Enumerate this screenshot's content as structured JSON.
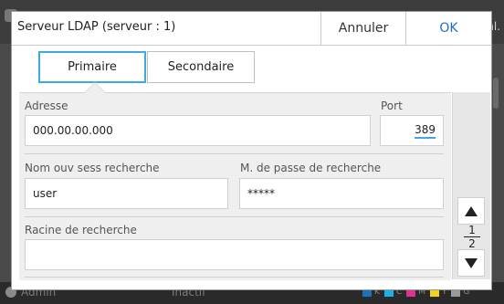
{
  "dialog": {
    "title": "Serveur LDAP (serveur : 1)",
    "cancel_label": "Annuler",
    "ok_label": "OK"
  },
  "tabs": [
    {
      "label": "Primaire",
      "selected": true
    },
    {
      "label": "Secondaire",
      "selected": false
    }
  ],
  "form": {
    "address": {
      "label": "Adresse",
      "value": "000.00.00.000"
    },
    "port": {
      "label": "Port",
      "value": "389"
    },
    "search_user": {
      "label": "Nom ouv sess recherche",
      "value": "user"
    },
    "search_password": {
      "label": "M. de passe de recherche",
      "value": "*****"
    },
    "search_root": {
      "label": "Racine de recherche",
      "value": ""
    }
  },
  "pager": {
    "current": "1",
    "total": "2"
  },
  "background": {
    "topbar_fragment": "nl.",
    "status_user": "Admin",
    "status_state": "Inactif",
    "inks": [
      {
        "label": "K",
        "color": "#1a1a1a"
      },
      {
        "label": "C",
        "color": "#1eaee8"
      },
      {
        "label": "M",
        "color": "#e0338f"
      },
      {
        "label": "Y",
        "color": "#f2d21f"
      },
      {
        "label": "G",
        "color": "#9a9a9a"
      }
    ]
  },
  "colors": {
    "accent": "#3fa9e8",
    "ok_text": "#1f6fc0",
    "panel_bg": "#efefef"
  }
}
